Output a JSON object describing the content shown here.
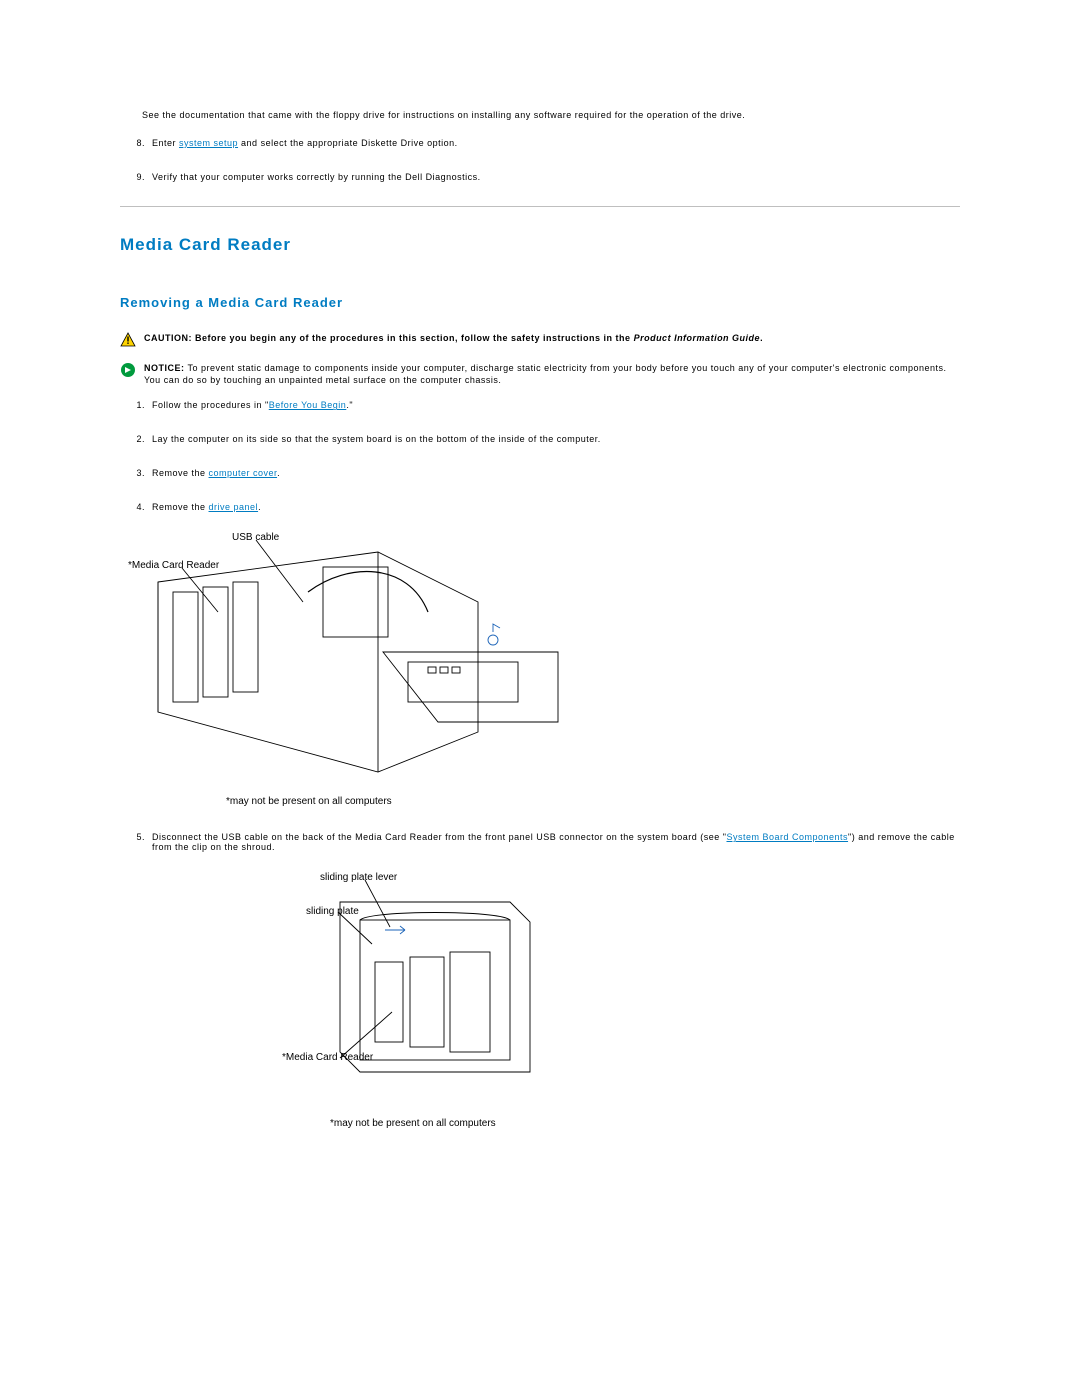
{
  "intro": {
    "text": "See the documentation that came with the floppy drive for instructions on installing any software required for the operation of the drive."
  },
  "topSteps": {
    "step8_a": "Enter ",
    "step8_link": "system setup",
    "step8_b": " and select the appropriate Diskette Drive option.",
    "step9": "Verify that your computer works correctly by running the Dell Diagnostics."
  },
  "headings": {
    "main": "Media Card Reader",
    "sub": "Removing a Media Card Reader"
  },
  "caution": {
    "label": "CAUTION: ",
    "text_a": "Before you begin any of the procedures in this section, follow the safety instructions in the ",
    "italic": "Product Information Guide",
    "text_b": "."
  },
  "notice": {
    "label": "NOTICE: ",
    "text": "To prevent static damage to components inside your computer, discharge static electricity from your body before you touch any of your computer's electronic components. You can do so by touching an unpainted metal surface on the computer chassis."
  },
  "procSteps": {
    "s1_a": "Follow the procedures in \"",
    "s1_link": "Before You Begin",
    "s1_b": ".\"",
    "s2": "Lay the computer on its side so that the system board is on the bottom of the inside of the computer.",
    "s3_a": "Remove the ",
    "s3_link": "computer cover",
    "s3_b": ".",
    "s4_a": "Remove the ",
    "s4_link": "drive panel",
    "s4_b": ".",
    "s5_a": "Disconnect the USB cable on the back of the Media Card Reader from the front panel USB connector on the system board (see \"",
    "s5_link": "System Board Components",
    "s5_b": "\") and remove the cable from the clip on the shroud."
  },
  "diagram1": {
    "usb_cable": "USB cable",
    "media_card_reader": "*Media Card Reader",
    "footnote": "*may not be present on all computers"
  },
  "diagram2": {
    "sliding_plate_lever": "sliding plate lever",
    "sliding_plate": "sliding plate",
    "media_card_reader": "*Media Card Reader",
    "footnote": "*may not be present on all computers"
  }
}
